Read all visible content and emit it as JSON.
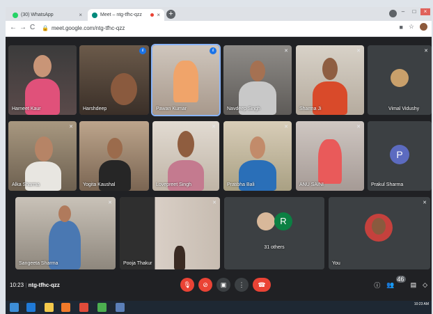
{
  "browser": {
    "tabs": [
      {
        "title": "(30) WhatsApp",
        "close": "×"
      },
      {
        "title": "Meet – ntg-tfhc-qzz",
        "close": "×"
      }
    ],
    "new_tab": "+",
    "url": "meet.google.com/ntg-tfhc-qzz",
    "nav": {
      "back": "←",
      "forward": "→",
      "reload": "C"
    }
  },
  "participants": [
    {
      "name": "Harneet Kaur"
    },
    {
      "name": "Harshdeep"
    },
    {
      "name": "Pawan Kumar"
    },
    {
      "name": "Navdeep Singh"
    },
    {
      "name": "Sharma Ji"
    },
    {
      "name": "Vimal Vidushy"
    },
    {
      "name": "Alka Sharma"
    },
    {
      "name": "Yogita Kaushal"
    },
    {
      "name": "Lovepreet Singh"
    },
    {
      "name": "Pratibha Bali"
    },
    {
      "name": "ANU SAINI"
    },
    {
      "name": "Prakul Sharma",
      "initial": "P"
    },
    {
      "name": "Sangeeta Sharma"
    },
    {
      "name": "Pooja Thakur"
    },
    {
      "name": "31 others",
      "initial": "R"
    },
    {
      "name": "You"
    }
  ],
  "meeting": {
    "time": "10:23",
    "code": "ntg-tfhc-qzz",
    "people_count": "46"
  },
  "taskbar": {
    "clock": "10:23 AM"
  },
  "colors": {
    "meet_bg": "#202124",
    "accent_blue": "#1a73e8",
    "end_red": "#ea4335",
    "prakul_avatar": "#5c6bc0",
    "r_avatar": "#0b8043"
  }
}
